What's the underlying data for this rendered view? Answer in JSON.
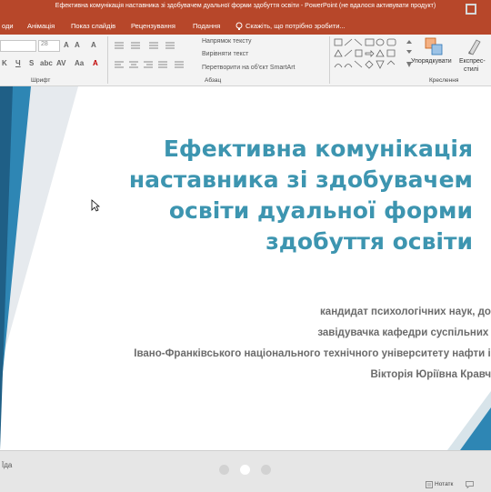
{
  "window": {
    "title": "Ефективна комунікація наставника зі здобувачем дуальної форми здобуття освіти - PowerPoint (не вдалося активувати продукт)"
  },
  "ribbon_tabs": [
    {
      "label": "оди"
    },
    {
      "label": "Анімація"
    },
    {
      "label": "Показ слайдів"
    },
    {
      "label": "Рецензування"
    },
    {
      "label": "Подання"
    },
    {
      "label": "Скажіть, що потрібно зробити..."
    }
  ],
  "ribbon": {
    "font_size_value": "28",
    "paragraph_text_direction": "Напрямок тексту",
    "paragraph_align_text": "Вирівняти текст",
    "paragraph_smartart": "Перетворити на об'єкт SmartArt",
    "group_font": "Шрифт",
    "group_paragraph": "Абзац",
    "group_drawing": "Креслення",
    "arrange_label": "Упорядкувати",
    "quick_styles_label_1": "Експрес-",
    "quick_styles_label_2": "стилі"
  },
  "slide": {
    "title_lines": [
      "Ефективна комунікація",
      "наставника зі здобувачем",
      "освіти дуальної форми",
      "здобуття освіти"
    ],
    "subtitle_lines": [
      "кандидат психологічних наук, доцент",
      "завідувачка кафедри суспільних наук",
      "Івано-Франківського національного технічного університету нафти і газу",
      "Вікторія Юріївна Кравченко"
    ]
  },
  "status": {
    "left_text": "Їда",
    "notes_label": "Нотатк"
  },
  "colors": {
    "accent": "#b7472a",
    "title_text": "#3d95b0",
    "subtitle_text": "#6b6b6b",
    "slide_decor": "#2e86b4"
  }
}
